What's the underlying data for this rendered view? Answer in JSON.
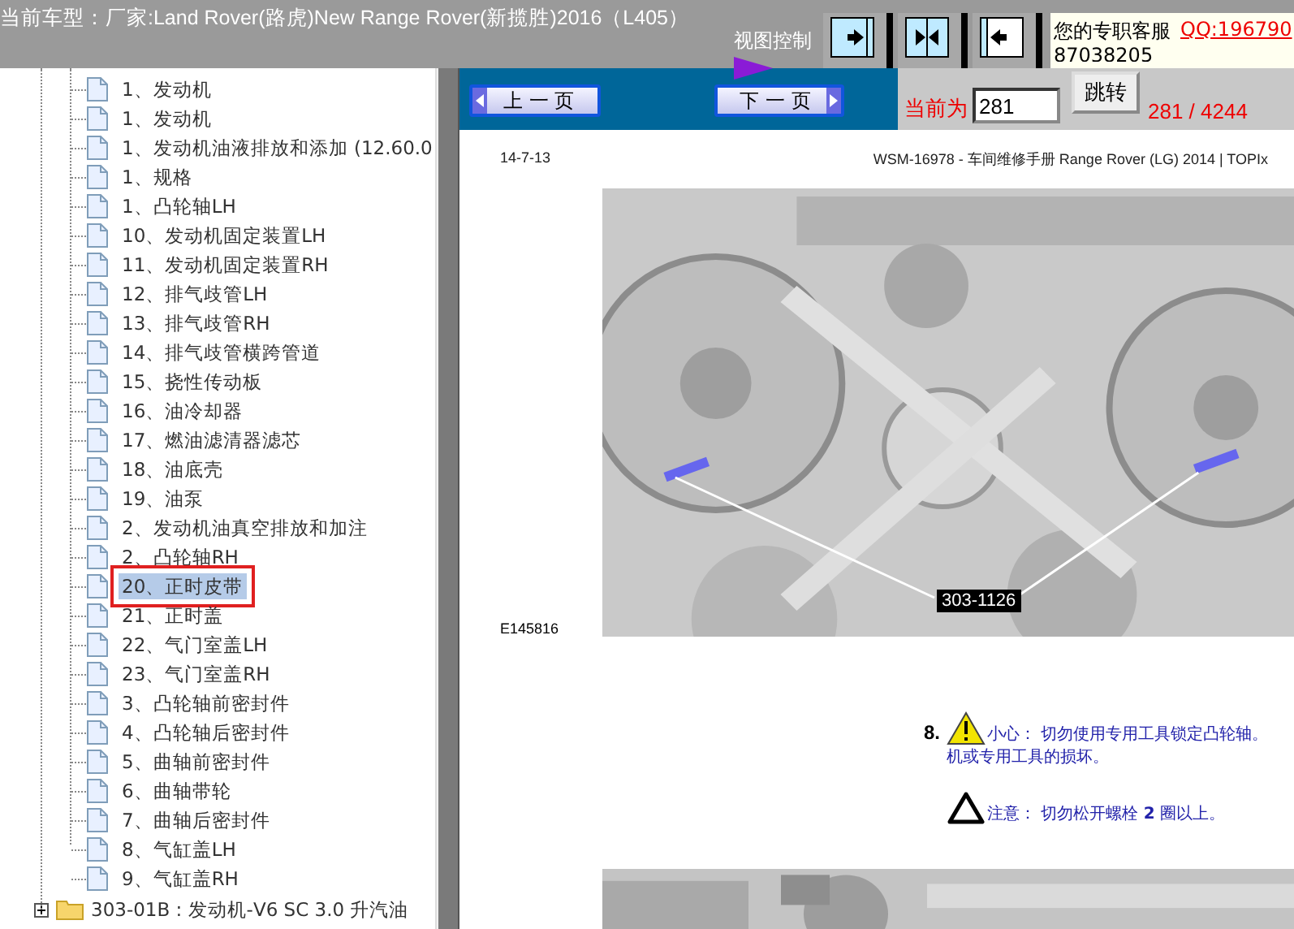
{
  "header": {
    "title": "当前车型：厂家:Land Rover(路虎)New Range Rover(新揽胜)2016（L405）",
    "view_control": "视图控制",
    "view_buttons": [
      {
        "kind": "right"
      },
      {
        "kind": "both"
      },
      {
        "kind": "left"
      }
    ],
    "service": {
      "label": "您的专职客服",
      "qq": "QQ:196790",
      "number": "87038205"
    }
  },
  "tree": {
    "items": [
      {
        "label": "1、发动机",
        "selected": false,
        "boxed": false
      },
      {
        "label": "1、发动机",
        "selected": false,
        "boxed": false
      },
      {
        "label": "1、发动机油液排放和添加 (12.60.0",
        "selected": false,
        "boxed": false
      },
      {
        "label": "1、规格",
        "selected": false,
        "boxed": false
      },
      {
        "label": "1、凸轮轴LH",
        "selected": false,
        "boxed": false
      },
      {
        "label": "10、发动机固定装置LH",
        "selected": false,
        "boxed": false
      },
      {
        "label": "11、发动机固定装置RH",
        "selected": false,
        "boxed": false
      },
      {
        "label": "12、排气歧管LH",
        "selected": false,
        "boxed": false
      },
      {
        "label": "13、排气歧管RH",
        "selected": false,
        "boxed": false
      },
      {
        "label": "14、排气歧管横跨管道",
        "selected": false,
        "boxed": false
      },
      {
        "label": "15、挠性传动板",
        "selected": false,
        "boxed": false
      },
      {
        "label": "16、油冷却器",
        "selected": false,
        "boxed": false
      },
      {
        "label": "17、燃油滤清器滤芯",
        "selected": false,
        "boxed": false
      },
      {
        "label": "18、油底壳",
        "selected": false,
        "boxed": false
      },
      {
        "label": "19、油泵",
        "selected": false,
        "boxed": false
      },
      {
        "label": "2、发动机油真空排放和加注",
        "selected": false,
        "boxed": false
      },
      {
        "label": "2、凸轮轴RH",
        "selected": false,
        "boxed": false
      },
      {
        "label": "20、正时皮带",
        "selected": true,
        "boxed": true
      },
      {
        "label": "21、正时盖",
        "selected": false,
        "boxed": false
      },
      {
        "label": "22、气门室盖LH",
        "selected": false,
        "boxed": false
      },
      {
        "label": "23、气门室盖RH",
        "selected": false,
        "boxed": false
      },
      {
        "label": "3、凸轮轴前密封件",
        "selected": false,
        "boxed": false
      },
      {
        "label": "4、凸轮轴后密封件",
        "selected": false,
        "boxed": false
      },
      {
        "label": "5、曲轴前密封件",
        "selected": false,
        "boxed": false
      },
      {
        "label": "6、曲轴带轮",
        "selected": false,
        "boxed": false
      },
      {
        "label": "7、曲轴后密封件",
        "selected": false,
        "boxed": false
      },
      {
        "label": "8、气缸盖LH",
        "selected": false,
        "boxed": false
      },
      {
        "label": "9、气缸盖RH",
        "selected": false,
        "boxed": false
      }
    ],
    "folder": {
      "label": "303-01B : 发动机-V6 SC 3.0 升汽油",
      "expanded": false
    }
  },
  "nav": {
    "prev": "上 一 页",
    "next": "下 一 页",
    "current_label": "当前为",
    "page_input": "281",
    "go": "跳转",
    "page_count": "281 / 4244"
  },
  "document": {
    "date": "14-7-13",
    "title": "WSM-16978 - 车间维修手册 Range Rover (LG) 2014 | TOPIx",
    "figure": {
      "kind": "picture",
      "callout": "303-1126",
      "figure_id": "E145816"
    },
    "step": {
      "number": "8.",
      "notes": [
        {
          "kind": "caution",
          "lines": [
            "小心：  切勿使用专用工具锁定凸轮轴。",
            "机或专用工具的损坏。"
          ]
        },
        {
          "kind": "note",
          "lines": [
            "注意：  切勿松开螺栓 **2** 圈以上。"
          ]
        }
      ]
    }
  }
}
